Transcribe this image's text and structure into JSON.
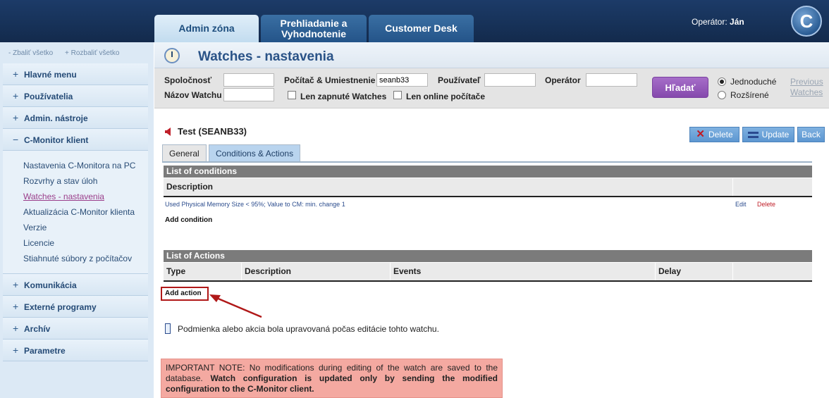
{
  "header": {
    "tabs": [
      {
        "label": "Admin zóna"
      },
      {
        "label": "Prehliadanie a Vyhodnotenie"
      },
      {
        "label": "Customer Desk"
      }
    ],
    "operator_label": "Operátor:",
    "operator_name": "Ján",
    "logo_letter": "C"
  },
  "sidebar": {
    "collapse_all": "- Zbaliť všetko",
    "expand_all": "+ Rozbaliť všetko",
    "categories": [
      {
        "symbol": "+",
        "label": "Hlavné menu"
      },
      {
        "symbol": "+",
        "label": "Používatelia"
      },
      {
        "symbol": "+",
        "label": "Admin. nástroje"
      },
      {
        "symbol": "−",
        "label": "C-Monitor klient"
      },
      {
        "symbol": "+",
        "label": "Komunikácia"
      },
      {
        "symbol": "+",
        "label": "Externé programy"
      },
      {
        "symbol": "+",
        "label": "Archív"
      },
      {
        "symbol": "+",
        "label": "Parametre"
      }
    ],
    "subitems": [
      "Nastavenia C-Monitora na PC",
      "Rozvrhy a stav úloh",
      "Watches - nastavenia",
      "Aktualizácia C-Monitor klienta",
      "Verzie",
      "Licencie",
      "Stiahnuté súbory z počítačov"
    ]
  },
  "page": {
    "title": "Watches - nastavenia"
  },
  "filters": {
    "company_label": "Spoločnosť",
    "company_value": "",
    "computer_label": "Počítač & Umiestnenie",
    "computer_value": "seanb33",
    "user_label": "Používateľ",
    "user_value": "",
    "operator_label": "Operátor",
    "operator_value": "",
    "watch_name_label": "Názov Watchu",
    "watch_name_value": "",
    "only_enabled_label": "Len zapnuté Watches",
    "only_online_label": "Len online počítače",
    "search_button": "Hľadať",
    "mode_simple": "Jednoduché",
    "mode_extended": "Rozšírené",
    "previous_watches": "Previous Watches"
  },
  "record": {
    "title": "Test (SEANB33)",
    "delete_button": "Delete",
    "update_button": "Update",
    "back_button": "Back",
    "tab_general": "General",
    "tab_conditions": "Conditions & Actions"
  },
  "conditions": {
    "section_title": "List of conditions",
    "col_description": "Description",
    "rows": [
      {
        "description": "Used Physical Memory Size < 95%; Value to CM: min. change 1",
        "edit": "Edit",
        "delete": "Delete"
      }
    ],
    "add_link": "Add condition"
  },
  "actions": {
    "section_title": "List of Actions",
    "col_type": "Type",
    "col_description": "Description",
    "col_events": "Events",
    "col_delay": "Delay",
    "add_link": "Add action"
  },
  "legend": {
    "text": "Podmienka alebo akcia bola upravovaná počas editácie tohto watchu."
  },
  "note": {
    "part1": "IMPORTANT NOTE: No modifications during editing of the watch are saved to the database.",
    "part2": "Watch configuration is updated only by sending the modified configuration to the C-Monitor client."
  },
  "colors": {
    "header_bg": "#173259",
    "accent": "#2a5387",
    "search_button": "#8549ad",
    "note_bg": "#f4a9a1",
    "highlight": "#b01818"
  }
}
